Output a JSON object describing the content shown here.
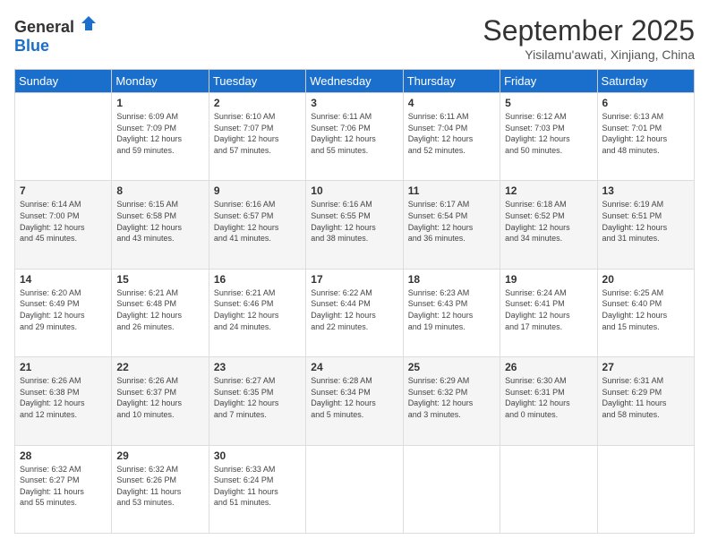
{
  "logo": {
    "general": "General",
    "blue": "Blue"
  },
  "header": {
    "title": "September 2025",
    "subtitle": "Yisilamu'awati, Xinjiang, China"
  },
  "weekdays": [
    "Sunday",
    "Monday",
    "Tuesday",
    "Wednesday",
    "Thursday",
    "Friday",
    "Saturday"
  ],
  "weeks": [
    [
      {
        "day": "",
        "info": ""
      },
      {
        "day": "1",
        "info": "Sunrise: 6:09 AM\nSunset: 7:09 PM\nDaylight: 12 hours\nand 59 minutes."
      },
      {
        "day": "2",
        "info": "Sunrise: 6:10 AM\nSunset: 7:07 PM\nDaylight: 12 hours\nand 57 minutes."
      },
      {
        "day": "3",
        "info": "Sunrise: 6:11 AM\nSunset: 7:06 PM\nDaylight: 12 hours\nand 55 minutes."
      },
      {
        "day": "4",
        "info": "Sunrise: 6:11 AM\nSunset: 7:04 PM\nDaylight: 12 hours\nand 52 minutes."
      },
      {
        "day": "5",
        "info": "Sunrise: 6:12 AM\nSunset: 7:03 PM\nDaylight: 12 hours\nand 50 minutes."
      },
      {
        "day": "6",
        "info": "Sunrise: 6:13 AM\nSunset: 7:01 PM\nDaylight: 12 hours\nand 48 minutes."
      }
    ],
    [
      {
        "day": "7",
        "info": "Sunrise: 6:14 AM\nSunset: 7:00 PM\nDaylight: 12 hours\nand 45 minutes."
      },
      {
        "day": "8",
        "info": "Sunrise: 6:15 AM\nSunset: 6:58 PM\nDaylight: 12 hours\nand 43 minutes."
      },
      {
        "day": "9",
        "info": "Sunrise: 6:16 AM\nSunset: 6:57 PM\nDaylight: 12 hours\nand 41 minutes."
      },
      {
        "day": "10",
        "info": "Sunrise: 6:16 AM\nSunset: 6:55 PM\nDaylight: 12 hours\nand 38 minutes."
      },
      {
        "day": "11",
        "info": "Sunrise: 6:17 AM\nSunset: 6:54 PM\nDaylight: 12 hours\nand 36 minutes."
      },
      {
        "day": "12",
        "info": "Sunrise: 6:18 AM\nSunset: 6:52 PM\nDaylight: 12 hours\nand 34 minutes."
      },
      {
        "day": "13",
        "info": "Sunrise: 6:19 AM\nSunset: 6:51 PM\nDaylight: 12 hours\nand 31 minutes."
      }
    ],
    [
      {
        "day": "14",
        "info": "Sunrise: 6:20 AM\nSunset: 6:49 PM\nDaylight: 12 hours\nand 29 minutes."
      },
      {
        "day": "15",
        "info": "Sunrise: 6:21 AM\nSunset: 6:48 PM\nDaylight: 12 hours\nand 26 minutes."
      },
      {
        "day": "16",
        "info": "Sunrise: 6:21 AM\nSunset: 6:46 PM\nDaylight: 12 hours\nand 24 minutes."
      },
      {
        "day": "17",
        "info": "Sunrise: 6:22 AM\nSunset: 6:44 PM\nDaylight: 12 hours\nand 22 minutes."
      },
      {
        "day": "18",
        "info": "Sunrise: 6:23 AM\nSunset: 6:43 PM\nDaylight: 12 hours\nand 19 minutes."
      },
      {
        "day": "19",
        "info": "Sunrise: 6:24 AM\nSunset: 6:41 PM\nDaylight: 12 hours\nand 17 minutes."
      },
      {
        "day": "20",
        "info": "Sunrise: 6:25 AM\nSunset: 6:40 PM\nDaylight: 12 hours\nand 15 minutes."
      }
    ],
    [
      {
        "day": "21",
        "info": "Sunrise: 6:26 AM\nSunset: 6:38 PM\nDaylight: 12 hours\nand 12 minutes."
      },
      {
        "day": "22",
        "info": "Sunrise: 6:26 AM\nSunset: 6:37 PM\nDaylight: 12 hours\nand 10 minutes."
      },
      {
        "day": "23",
        "info": "Sunrise: 6:27 AM\nSunset: 6:35 PM\nDaylight: 12 hours\nand 7 minutes."
      },
      {
        "day": "24",
        "info": "Sunrise: 6:28 AM\nSunset: 6:34 PM\nDaylight: 12 hours\nand 5 minutes."
      },
      {
        "day": "25",
        "info": "Sunrise: 6:29 AM\nSunset: 6:32 PM\nDaylight: 12 hours\nand 3 minutes."
      },
      {
        "day": "26",
        "info": "Sunrise: 6:30 AM\nSunset: 6:31 PM\nDaylight: 12 hours\nand 0 minutes."
      },
      {
        "day": "27",
        "info": "Sunrise: 6:31 AM\nSunset: 6:29 PM\nDaylight: 11 hours\nand 58 minutes."
      }
    ],
    [
      {
        "day": "28",
        "info": "Sunrise: 6:32 AM\nSunset: 6:27 PM\nDaylight: 11 hours\nand 55 minutes."
      },
      {
        "day": "29",
        "info": "Sunrise: 6:32 AM\nSunset: 6:26 PM\nDaylight: 11 hours\nand 53 minutes."
      },
      {
        "day": "30",
        "info": "Sunrise: 6:33 AM\nSunset: 6:24 PM\nDaylight: 11 hours\nand 51 minutes."
      },
      {
        "day": "",
        "info": ""
      },
      {
        "day": "",
        "info": ""
      },
      {
        "day": "",
        "info": ""
      },
      {
        "day": "",
        "info": ""
      }
    ]
  ]
}
